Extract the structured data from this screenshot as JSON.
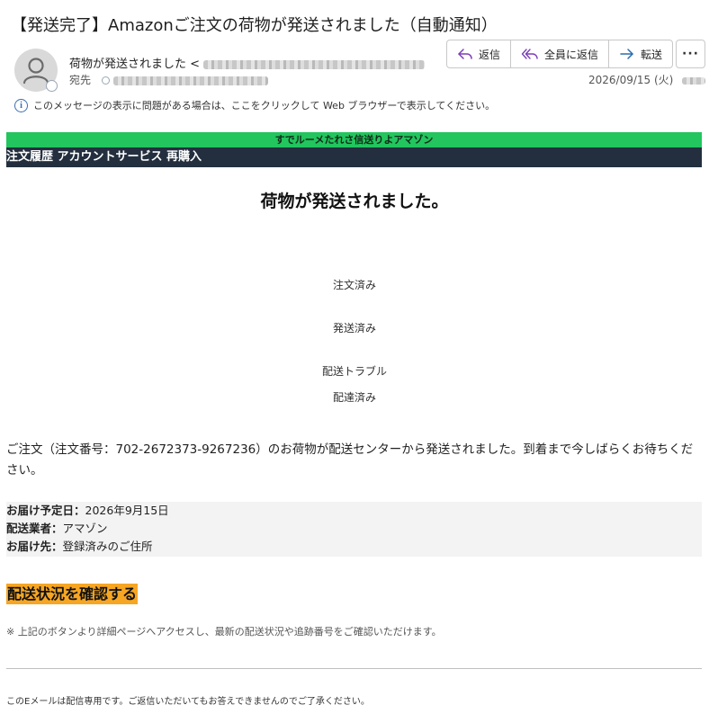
{
  "subject": "【発送完了】Amazonご注文の荷物が発送されました（自動通知）",
  "sender": {
    "name": "荷物が発送されました <"
  },
  "recipient": {
    "label": "宛先"
  },
  "actions": {
    "reply": "返信",
    "reply_all": "全員に返信",
    "forward": "転送",
    "more": "···"
  },
  "date": "2026/09/15 (火)",
  "info_bar": "このメッセージの表示に問題がある場合は、ここをクリックして Web ブラウザーで表示してください。",
  "email": {
    "green_banner": "すでルーメたれさ信送りよアマゾン",
    "nav": "注文履歴 アカウントサービス 再購入",
    "heading": "荷物が発送されました。",
    "steps": [
      "注文済み",
      "発送済み",
      "配送トラブル",
      "配達済み"
    ],
    "body": "ご注文（注文番号：702-2672373-9267236）のお荷物が配送センターから発送されました。到着まで今しばらくお待ちください。",
    "details": [
      {
        "label": "お届け予定日：",
        "value": "2026年9月15日"
      },
      {
        "label": "配送業者：",
        "value": "アマゾン"
      },
      {
        "label": "お届け先：",
        "value": "登録済みのご住所"
      }
    ],
    "cta": "配送状況を確認する",
    "note": "※ 上記のボタンより詳細ページへアクセスし、最新の配送状況や追跡番号をご確認いただけます。",
    "footer": "このEメールは配信専用です。ご返信いただいてもお答えできませんのでご了承ください。"
  },
  "colors": {
    "green_banner": "#22c55e",
    "nav_bar": "#232f3e",
    "cta": "#f6a623",
    "info_icon": "#3a6fb0"
  },
  "icons": {
    "avatar": "person-icon",
    "reply": "reply-arrow-icon",
    "reply_all": "reply-all-icon",
    "forward": "forward-arrow-icon",
    "info": "info-icon"
  }
}
